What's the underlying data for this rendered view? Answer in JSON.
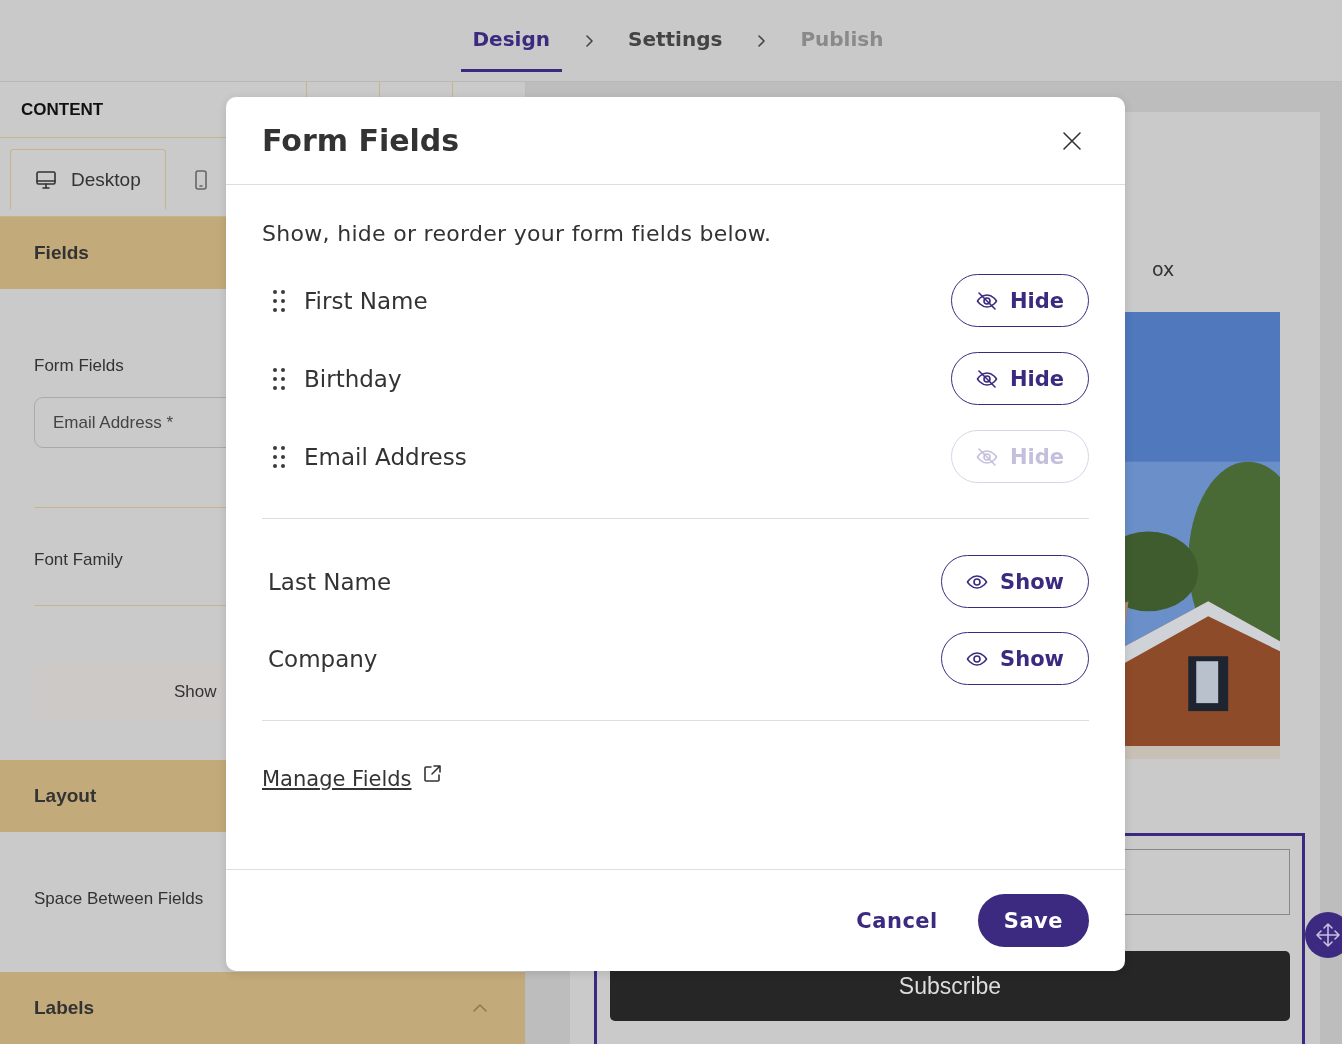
{
  "steps": [
    {
      "label": "Design",
      "selected": true,
      "disabled": false
    },
    {
      "label": "Settings",
      "selected": false,
      "disabled": false
    },
    {
      "label": "Publish",
      "selected": false,
      "disabled": true
    }
  ],
  "sidebar": {
    "title": "CONTENT",
    "devices": [
      {
        "label": "Desktop",
        "kind": "desktop",
        "selected": true
      },
      {
        "kind": "mobile",
        "selected": false
      }
    ],
    "sections": [
      {
        "title": "Fields",
        "items": [
          {
            "kind": "label",
            "text": "Form Fields"
          },
          {
            "kind": "chip",
            "text": "Email Address *"
          },
          {
            "kind": "rule"
          },
          {
            "kind": "label",
            "text": "Font Family"
          },
          {
            "kind": "rule"
          },
          {
            "kind": "button",
            "text": "Show"
          }
        ]
      },
      {
        "title": "Layout",
        "items": [
          {
            "kind": "label",
            "text": "Space Between Fields"
          }
        ]
      },
      {
        "title": "Labels",
        "expanded": true
      }
    ]
  },
  "preview": {
    "heading": "ox",
    "button": "Subscribe"
  },
  "modal": {
    "title": "Form Fields",
    "intro": "Show, hide or reorder your form fields below.",
    "visible_fields": [
      {
        "label": "First Name",
        "action": "Hide",
        "disabled": false
      },
      {
        "label": "Birthday",
        "action": "Hide",
        "disabled": false
      },
      {
        "label": "Email Address",
        "action": "Hide",
        "disabled": true
      }
    ],
    "hidden_fields": [
      {
        "label": "Last Name",
        "action": "Show"
      },
      {
        "label": "Company",
        "action": "Show"
      }
    ],
    "link": "Manage Fields",
    "cancel": "Cancel",
    "save": "Save"
  }
}
